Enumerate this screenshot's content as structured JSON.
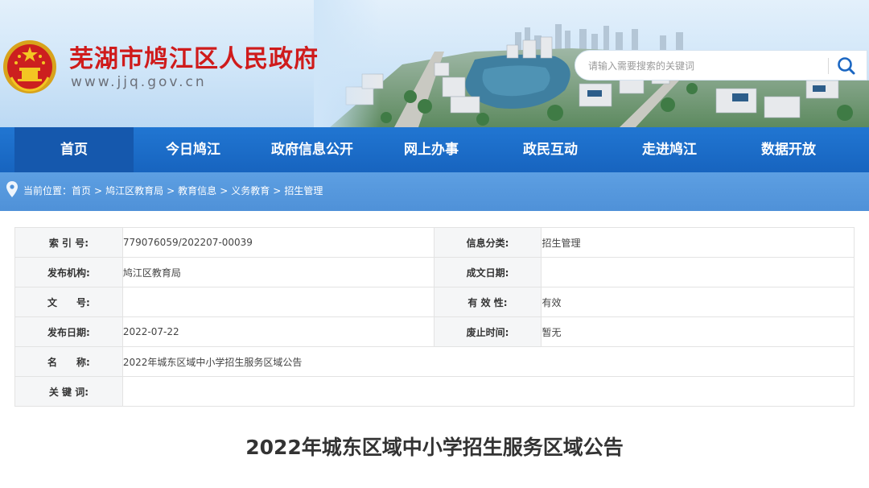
{
  "header": {
    "site_name": "芜湖市鸠江区人民政府",
    "site_domain": "www.jjq.gov.cn",
    "search_placeholder": "请输入需要搜索的关键词"
  },
  "nav": {
    "items": [
      "首页",
      "今日鸠江",
      "政府信息公开",
      "网上办事",
      "政民互动",
      "走进鸠江",
      "数据开放"
    ]
  },
  "breadcrumb": {
    "prefix": "当前位置：",
    "items": [
      "首页",
      "鸠江区教育局",
      "教育信息",
      "义务教育",
      "招生管理"
    ],
    "separator": ">"
  },
  "meta": {
    "index_label": "索 引 号:",
    "index_value": "779076059/202207-00039",
    "category_label": "信息分类:",
    "category_value": "招生管理",
    "publisher_label": "发布机构:",
    "publisher_value": "鸠江区教育局",
    "written_date_label": "成文日期:",
    "written_date_value": "",
    "doc_no_label": "文　　号:",
    "doc_no_value": "",
    "validity_label": "有 效 性:",
    "validity_value": "有效",
    "publish_date_label": "发布日期:",
    "publish_date_value": "2022-07-22",
    "expiry_label": "废止时间:",
    "expiry_value": "暂无",
    "name_label": "名　　称:",
    "name_value": "2022年城东区域中小学招生服务区域公告",
    "keywords_label": "关 键 词:",
    "keywords_value": ""
  },
  "article": {
    "title": "2022年城东区域中小学招生服务区域公告"
  },
  "colors": {
    "nav_bg": "#1764bf",
    "nav_active": "#1558ad",
    "breadcrumb_bg": "#4f91d8",
    "site_name": "#cf1b1b"
  }
}
